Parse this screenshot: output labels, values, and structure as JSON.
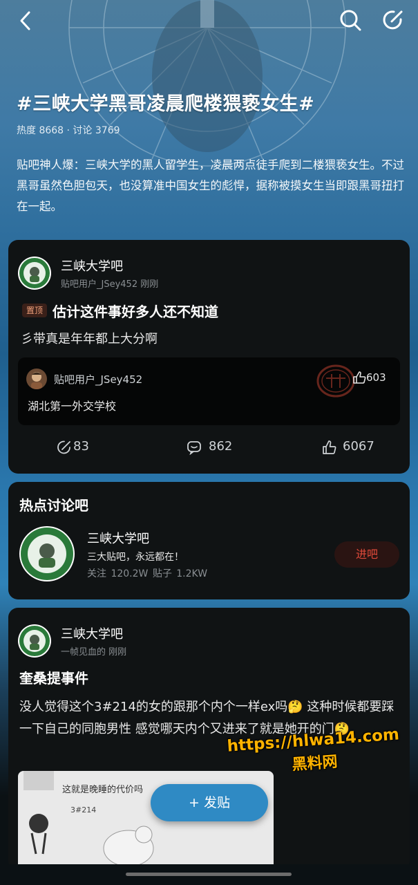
{
  "topic": {
    "title": "#三峡大学黑哥凌晨爬楼猥亵女生#",
    "stats": "热度 8668 · 讨论 3769",
    "description": "贴吧神人爆：三峡大学的黑人留学生，凌晨两点徒手爬到二楼猥亵女生。不过黑哥虽然色胆包天，也没算准中国女生的彪悍，据称被摸女生当即跟黑哥扭打在一起。"
  },
  "post1": {
    "forum_name": "三峡大学吧",
    "meta": "贴吧用户_JSey452 刚刚",
    "pin_badge": "置顶",
    "title": "估计这件事好多人还不知道",
    "body": "彡带真是年年都上大分啊",
    "hot_comment": {
      "user": "贴吧用户_JSey452",
      "text": "湖北第一外交学校",
      "likes": "603",
      "stamp": "热评"
    },
    "actions": {
      "share": "83",
      "comments": "862",
      "likes": "6067"
    }
  },
  "hot_forum": {
    "section_title": "热点讨论吧",
    "name": "三峡大学吧",
    "slogan": "三大贴吧，永远都在！",
    "stats": "关注 120.2W   贴子 1.2KW",
    "enter_label": "进吧"
  },
  "post2": {
    "forum_name": "三峡大学吧",
    "meta": "一帧见血的 刚刚",
    "title": "奎桑提事件",
    "body": "没人觉得这个3#214的女的跟那个内个一样ex吗🤔 这种时候都要踩一下自己的同胞男性 感觉哪天内个又进来了就是她开的门🤔",
    "image_caption": "这就是晚睡的代价吗",
    "image_label": "3#214"
  },
  "fab_label": "+ 发贴",
  "watermark": {
    "url": "https://hlwa14.com",
    "name": "黑料网"
  },
  "colors": {
    "accent_blue": "#2f8ac4",
    "enter_red": "#e04a3a",
    "card_bg": "#101314"
  },
  "icons": [
    "back-icon",
    "search-icon",
    "edit-icon",
    "share-icon",
    "comment-icon",
    "like-icon"
  ]
}
